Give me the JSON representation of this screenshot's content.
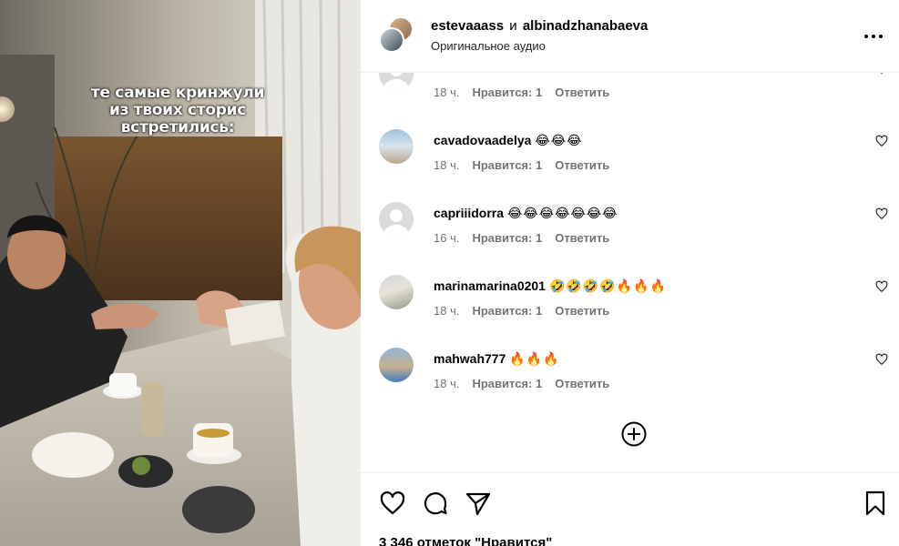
{
  "media": {
    "overlay_text": "те самые кринжули\nиз твоих сторис\nвстретились:"
  },
  "header": {
    "user1": "estevaaass",
    "conjunction": "и",
    "user2": "albinadzhanabaeva",
    "audio": "Оригинальное аудио",
    "more_icon": "more-horizontal-icon"
  },
  "comments": [
    {
      "user": "",
      "text": "😅😅",
      "time": "18 ч.",
      "likes": "Нравится: 1",
      "reply": "Ответить",
      "avatar": "default"
    },
    {
      "user": "cavadovaadelya",
      "text": "😂😂😂",
      "time": "18 ч.",
      "likes": "Нравится: 1",
      "reply": "Ответить",
      "avatar": "photo-beach"
    },
    {
      "user": "capriiidorra",
      "text": "😂😂😂😂😂😂😂",
      "time": "16 ч.",
      "likes": "Нравится: 1",
      "reply": "Ответить",
      "avatar": "default"
    },
    {
      "user": "marinamarina0201",
      "text": "🤣🤣🤣🤣🔥🔥🔥",
      "time": "18 ч.",
      "likes": "Нравится: 1",
      "reply": "Ответить",
      "avatar": "photo-outdoor"
    },
    {
      "user": "mahwah777",
      "text": "🔥🔥🔥",
      "time": "18 ч.",
      "likes": "Нравится: 1",
      "reply": "Ответить",
      "avatar": "photo-person"
    }
  ],
  "load_more_icon": "plus-circle-icon",
  "actions": {
    "like_icon": "heart-icon",
    "comment_icon": "comment-icon",
    "share_icon": "send-icon",
    "save_icon": "bookmark-icon",
    "likes_count": "3 346 отметок \"Нравится\""
  }
}
